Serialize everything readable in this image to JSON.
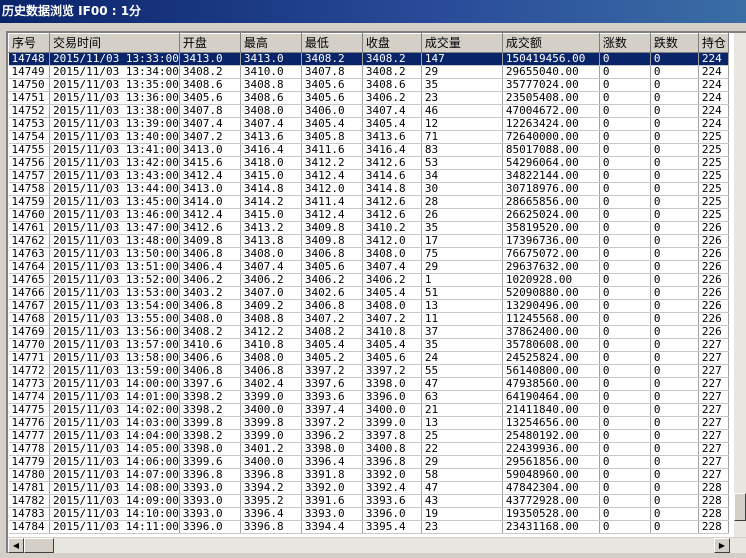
{
  "window": {
    "title": "历史数据浏览 IF00 : 1分"
  },
  "table": {
    "columns": [
      "序号",
      "交易时间",
      "开盘",
      "最高",
      "最低",
      "收盘",
      "成交量",
      "成交额",
      "涨数",
      "跌数",
      "持仓"
    ],
    "rows": [
      [
        "14748",
        "2015/11/03 13:33:00",
        "3413.0",
        "3413.0",
        "3408.2",
        "3408.2",
        "147",
        "150419456.00",
        "0",
        "0",
        "224"
      ],
      [
        "14749",
        "2015/11/03 13:34:00",
        "3408.2",
        "3410.0",
        "3407.8",
        "3408.2",
        "29",
        "29655040.00",
        "0",
        "0",
        "224"
      ],
      [
        "14750",
        "2015/11/03 13:35:00",
        "3408.6",
        "3408.8",
        "3405.6",
        "3408.6",
        "35",
        "35777024.00",
        "0",
        "0",
        "224"
      ],
      [
        "14751",
        "2015/11/03 13:36:00",
        "3405.6",
        "3408.6",
        "3405.6",
        "3406.2",
        "23",
        "23505408.00",
        "0",
        "0",
        "224"
      ],
      [
        "14752",
        "2015/11/03 13:38:00",
        "3407.8",
        "3408.0",
        "3406.0",
        "3407.4",
        "46",
        "47004672.00",
        "0",
        "0",
        "224"
      ],
      [
        "14753",
        "2015/11/03 13:39:00",
        "3407.4",
        "3407.4",
        "3405.4",
        "3405.4",
        "12",
        "12263424.00",
        "0",
        "0",
        "224"
      ],
      [
        "14754",
        "2015/11/03 13:40:00",
        "3407.2",
        "3413.6",
        "3405.8",
        "3413.6",
        "71",
        "72640000.00",
        "0",
        "0",
        "225"
      ],
      [
        "14755",
        "2015/11/03 13:41:00",
        "3413.0",
        "3416.4",
        "3411.6",
        "3416.4",
        "83",
        "85017088.00",
        "0",
        "0",
        "225"
      ],
      [
        "14756",
        "2015/11/03 13:42:00",
        "3415.6",
        "3418.0",
        "3412.2",
        "3412.6",
        "53",
        "54296064.00",
        "0",
        "0",
        "225"
      ],
      [
        "14757",
        "2015/11/03 13:43:00",
        "3412.4",
        "3415.0",
        "3412.4",
        "3414.6",
        "34",
        "34822144.00",
        "0",
        "0",
        "225"
      ],
      [
        "14758",
        "2015/11/03 13:44:00",
        "3413.0",
        "3414.8",
        "3412.0",
        "3414.8",
        "30",
        "30718976.00",
        "0",
        "0",
        "225"
      ],
      [
        "14759",
        "2015/11/03 13:45:00",
        "3414.0",
        "3414.2",
        "3411.4",
        "3412.6",
        "28",
        "28665856.00",
        "0",
        "0",
        "225"
      ],
      [
        "14760",
        "2015/11/03 13:46:00",
        "3412.4",
        "3415.0",
        "3412.4",
        "3412.6",
        "26",
        "26625024.00",
        "0",
        "0",
        "225"
      ],
      [
        "14761",
        "2015/11/03 13:47:00",
        "3412.6",
        "3413.2",
        "3409.8",
        "3410.2",
        "35",
        "35819520.00",
        "0",
        "0",
        "226"
      ],
      [
        "14762",
        "2015/11/03 13:48:00",
        "3409.8",
        "3413.8",
        "3409.8",
        "3412.0",
        "17",
        "17396736.00",
        "0",
        "0",
        "226"
      ],
      [
        "14763",
        "2015/11/03 13:50:00",
        "3406.8",
        "3408.0",
        "3406.8",
        "3408.0",
        "75",
        "76675072.00",
        "0",
        "0",
        "226"
      ],
      [
        "14764",
        "2015/11/03 13:51:00",
        "3406.4",
        "3407.4",
        "3405.6",
        "3407.4",
        "29",
        "29637632.00",
        "0",
        "0",
        "226"
      ],
      [
        "14765",
        "2015/11/03 13:52:00",
        "3406.2",
        "3406.2",
        "3406.2",
        "3406.2",
        "1",
        "1020928.00",
        "0",
        "0",
        "226"
      ],
      [
        "14766",
        "2015/11/03 13:53:00",
        "3403.2",
        "3407.0",
        "3402.6",
        "3405.4",
        "51",
        "52090880.00",
        "0",
        "0",
        "226"
      ],
      [
        "14767",
        "2015/11/03 13:54:00",
        "3406.8",
        "3409.2",
        "3406.8",
        "3408.0",
        "13",
        "13290496.00",
        "0",
        "0",
        "226"
      ],
      [
        "14768",
        "2015/11/03 13:55:00",
        "3408.0",
        "3408.8",
        "3407.2",
        "3407.2",
        "11",
        "11245568.00",
        "0",
        "0",
        "226"
      ],
      [
        "14769",
        "2015/11/03 13:56:00",
        "3408.2",
        "3412.2",
        "3408.2",
        "3410.8",
        "37",
        "37862400.00",
        "0",
        "0",
        "226"
      ],
      [
        "14770",
        "2015/11/03 13:57:00",
        "3410.6",
        "3410.8",
        "3405.4",
        "3405.4",
        "35",
        "35780608.00",
        "0",
        "0",
        "227"
      ],
      [
        "14771",
        "2015/11/03 13:58:00",
        "3406.6",
        "3408.0",
        "3405.2",
        "3405.6",
        "24",
        "24525824.00",
        "0",
        "0",
        "227"
      ],
      [
        "14772",
        "2015/11/03 13:59:00",
        "3406.8",
        "3406.8",
        "3397.2",
        "3397.2",
        "55",
        "56140800.00",
        "0",
        "0",
        "227"
      ],
      [
        "14773",
        "2015/11/03 14:00:00",
        "3397.6",
        "3402.4",
        "3397.6",
        "3398.0",
        "47",
        "47938560.00",
        "0",
        "0",
        "227"
      ],
      [
        "14774",
        "2015/11/03 14:01:00",
        "3398.2",
        "3399.0",
        "3393.6",
        "3396.0",
        "63",
        "64190464.00",
        "0",
        "0",
        "227"
      ],
      [
        "14775",
        "2015/11/03 14:02:00",
        "3398.2",
        "3400.0",
        "3397.4",
        "3400.0",
        "21",
        "21411840.00",
        "0",
        "0",
        "227"
      ],
      [
        "14776",
        "2015/11/03 14:03:00",
        "3399.8",
        "3399.8",
        "3397.2",
        "3399.0",
        "13",
        "13254656.00",
        "0",
        "0",
        "227"
      ],
      [
        "14777",
        "2015/11/03 14:04:00",
        "3398.2",
        "3399.0",
        "3396.2",
        "3397.8",
        "25",
        "25480192.00",
        "0",
        "0",
        "227"
      ],
      [
        "14778",
        "2015/11/03 14:05:00",
        "3398.0",
        "3401.2",
        "3398.0",
        "3400.8",
        "22",
        "22439936.00",
        "0",
        "0",
        "227"
      ],
      [
        "14779",
        "2015/11/03 14:06:00",
        "3399.6",
        "3400.0",
        "3396.4",
        "3396.8",
        "29",
        "29561856.00",
        "0",
        "0",
        "227"
      ],
      [
        "14780",
        "2015/11/03 14:07:00",
        "3396.8",
        "3396.8",
        "3391.8",
        "3392.0",
        "58",
        "59048960.00",
        "0",
        "0",
        "227"
      ],
      [
        "14781",
        "2015/11/03 14:08:00",
        "3393.0",
        "3394.2",
        "3392.0",
        "3392.4",
        "47",
        "47842304.00",
        "0",
        "0",
        "228"
      ],
      [
        "14782",
        "2015/11/03 14:09:00",
        "3393.0",
        "3395.2",
        "3391.6",
        "3393.6",
        "43",
        "43772928.00",
        "0",
        "0",
        "228"
      ],
      [
        "14783",
        "2015/11/03 14:10:00",
        "3393.0",
        "3396.4",
        "3393.0",
        "3396.0",
        "19",
        "19350528.00",
        "0",
        "0",
        "228"
      ],
      [
        "14784",
        "2015/11/03 14:11:00",
        "3396.0",
        "3396.8",
        "3394.4",
        "3395.4",
        "23",
        "23431168.00",
        "0",
        "0",
        "228"
      ]
    ],
    "selected_index": 0
  },
  "icons": {
    "scroll_left": "triangle-left-icon",
    "scroll_right": "triangle-right-icon"
  }
}
